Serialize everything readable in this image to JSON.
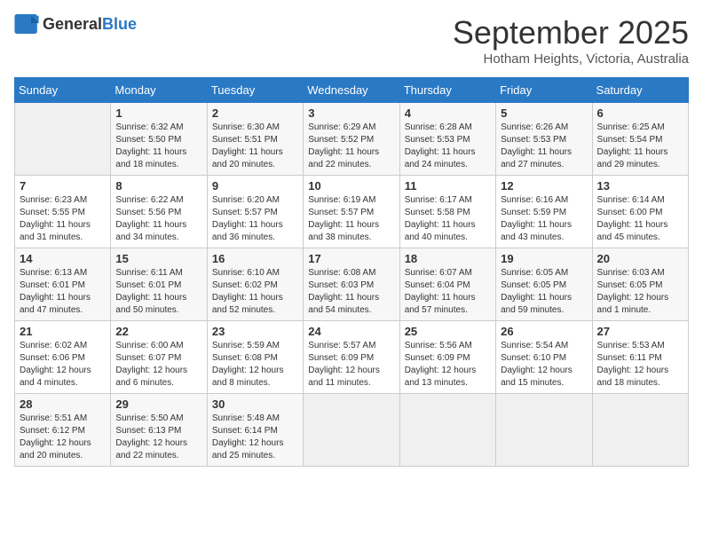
{
  "header": {
    "logo_general": "General",
    "logo_blue": "Blue",
    "month_year": "September 2025",
    "location": "Hotham Heights, Victoria, Australia"
  },
  "calendar": {
    "days_of_week": [
      "Sunday",
      "Monday",
      "Tuesday",
      "Wednesday",
      "Thursday",
      "Friday",
      "Saturday"
    ],
    "weeks": [
      [
        {
          "day": "",
          "info": ""
        },
        {
          "day": "1",
          "info": "Sunrise: 6:32 AM\nSunset: 5:50 PM\nDaylight: 11 hours\nand 18 minutes."
        },
        {
          "day": "2",
          "info": "Sunrise: 6:30 AM\nSunset: 5:51 PM\nDaylight: 11 hours\nand 20 minutes."
        },
        {
          "day": "3",
          "info": "Sunrise: 6:29 AM\nSunset: 5:52 PM\nDaylight: 11 hours\nand 22 minutes."
        },
        {
          "day": "4",
          "info": "Sunrise: 6:28 AM\nSunset: 5:53 PM\nDaylight: 11 hours\nand 24 minutes."
        },
        {
          "day": "5",
          "info": "Sunrise: 6:26 AM\nSunset: 5:53 PM\nDaylight: 11 hours\nand 27 minutes."
        },
        {
          "day": "6",
          "info": "Sunrise: 6:25 AM\nSunset: 5:54 PM\nDaylight: 11 hours\nand 29 minutes."
        }
      ],
      [
        {
          "day": "7",
          "info": "Sunrise: 6:23 AM\nSunset: 5:55 PM\nDaylight: 11 hours\nand 31 minutes."
        },
        {
          "day": "8",
          "info": "Sunrise: 6:22 AM\nSunset: 5:56 PM\nDaylight: 11 hours\nand 34 minutes."
        },
        {
          "day": "9",
          "info": "Sunrise: 6:20 AM\nSunset: 5:57 PM\nDaylight: 11 hours\nand 36 minutes."
        },
        {
          "day": "10",
          "info": "Sunrise: 6:19 AM\nSunset: 5:57 PM\nDaylight: 11 hours\nand 38 minutes."
        },
        {
          "day": "11",
          "info": "Sunrise: 6:17 AM\nSunset: 5:58 PM\nDaylight: 11 hours\nand 40 minutes."
        },
        {
          "day": "12",
          "info": "Sunrise: 6:16 AM\nSunset: 5:59 PM\nDaylight: 11 hours\nand 43 minutes."
        },
        {
          "day": "13",
          "info": "Sunrise: 6:14 AM\nSunset: 6:00 PM\nDaylight: 11 hours\nand 45 minutes."
        }
      ],
      [
        {
          "day": "14",
          "info": "Sunrise: 6:13 AM\nSunset: 6:01 PM\nDaylight: 11 hours\nand 47 minutes."
        },
        {
          "day": "15",
          "info": "Sunrise: 6:11 AM\nSunset: 6:01 PM\nDaylight: 11 hours\nand 50 minutes."
        },
        {
          "day": "16",
          "info": "Sunrise: 6:10 AM\nSunset: 6:02 PM\nDaylight: 11 hours\nand 52 minutes."
        },
        {
          "day": "17",
          "info": "Sunrise: 6:08 AM\nSunset: 6:03 PM\nDaylight: 11 hours\nand 54 minutes."
        },
        {
          "day": "18",
          "info": "Sunrise: 6:07 AM\nSunset: 6:04 PM\nDaylight: 11 hours\nand 57 minutes."
        },
        {
          "day": "19",
          "info": "Sunrise: 6:05 AM\nSunset: 6:05 PM\nDaylight: 11 hours\nand 59 minutes."
        },
        {
          "day": "20",
          "info": "Sunrise: 6:03 AM\nSunset: 6:05 PM\nDaylight: 12 hours\nand 1 minute."
        }
      ],
      [
        {
          "day": "21",
          "info": "Sunrise: 6:02 AM\nSunset: 6:06 PM\nDaylight: 12 hours\nand 4 minutes."
        },
        {
          "day": "22",
          "info": "Sunrise: 6:00 AM\nSunset: 6:07 PM\nDaylight: 12 hours\nand 6 minutes."
        },
        {
          "day": "23",
          "info": "Sunrise: 5:59 AM\nSunset: 6:08 PM\nDaylight: 12 hours\nand 8 minutes."
        },
        {
          "day": "24",
          "info": "Sunrise: 5:57 AM\nSunset: 6:09 PM\nDaylight: 12 hours\nand 11 minutes."
        },
        {
          "day": "25",
          "info": "Sunrise: 5:56 AM\nSunset: 6:09 PM\nDaylight: 12 hours\nand 13 minutes."
        },
        {
          "day": "26",
          "info": "Sunrise: 5:54 AM\nSunset: 6:10 PM\nDaylight: 12 hours\nand 15 minutes."
        },
        {
          "day": "27",
          "info": "Sunrise: 5:53 AM\nSunset: 6:11 PM\nDaylight: 12 hours\nand 18 minutes."
        }
      ],
      [
        {
          "day": "28",
          "info": "Sunrise: 5:51 AM\nSunset: 6:12 PM\nDaylight: 12 hours\nand 20 minutes."
        },
        {
          "day": "29",
          "info": "Sunrise: 5:50 AM\nSunset: 6:13 PM\nDaylight: 12 hours\nand 22 minutes."
        },
        {
          "day": "30",
          "info": "Sunrise: 5:48 AM\nSunset: 6:14 PM\nDaylight: 12 hours\nand 25 minutes."
        },
        {
          "day": "",
          "info": ""
        },
        {
          "day": "",
          "info": ""
        },
        {
          "day": "",
          "info": ""
        },
        {
          "day": "",
          "info": ""
        }
      ]
    ]
  }
}
